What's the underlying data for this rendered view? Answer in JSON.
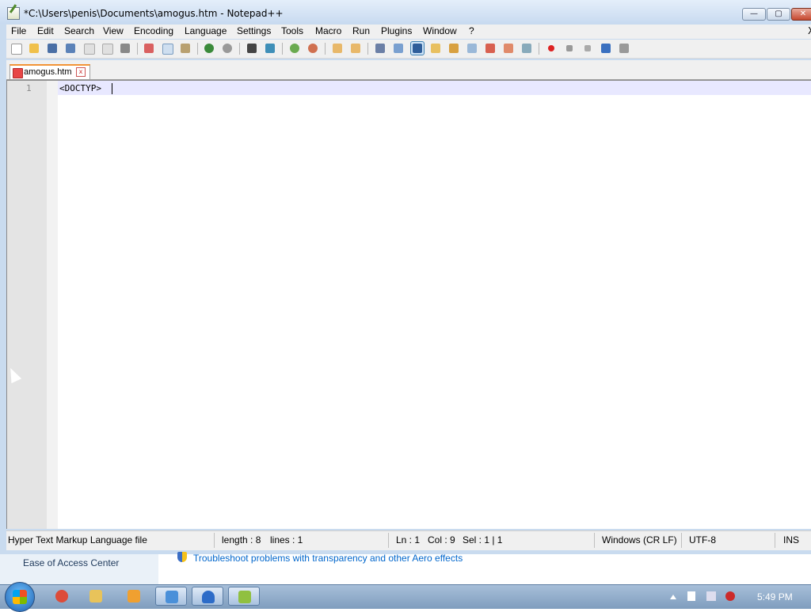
{
  "window": {
    "title": "*C:\\Users\\penis\\Documents\\amogus.htm - Notepad++",
    "minimize_glyph": "—",
    "maximize_glyph": "▢",
    "close_glyph": "✕"
  },
  "menu": {
    "items": [
      "File",
      "Edit",
      "Search",
      "View",
      "Encoding",
      "Language",
      "Settings",
      "Tools",
      "Macro",
      "Run",
      "Plugins",
      "Window",
      "?"
    ],
    "overflow_glyph": "X"
  },
  "toolbar": {
    "icons": [
      "new-file-icon",
      "open-file-icon",
      "save-icon",
      "save-all-icon",
      "close-icon",
      "close-all-icon",
      "print-icon",
      "cut-icon",
      "copy-icon",
      "paste-icon",
      "undo-icon",
      "redo-icon",
      "find-icon",
      "replace-icon",
      "zoom-in-icon",
      "zoom-out-icon",
      "sync-vertical-icon",
      "sync-horizontal-icon",
      "word-wrap-icon",
      "show-all-chars-icon",
      "indent-guide-icon",
      "user-language-icon",
      "doc-map-icon",
      "function-list-icon",
      "folder-workspace-icon",
      "monitoring-icon",
      "record-macro-icon",
      "stop-macro-icon",
      "play-macro-icon",
      "run-macro-multiple-icon",
      "save-macro-icon"
    ],
    "active_icon": "indent-guide-icon"
  },
  "tab": {
    "label": "amogus.htm",
    "close_glyph": "x"
  },
  "editor": {
    "line_number": "1",
    "code": "<DOCTYP>"
  },
  "status": {
    "file_type": "Hyper Text Markup Language file",
    "length": "length : 8",
    "lines": "lines : 1",
    "ln": "Ln : 1",
    "col": "Col : 9",
    "sel": "Sel : 1 | 1",
    "eol": "Windows (CR LF)",
    "encoding": "UTF-8",
    "mode": "INS"
  },
  "background": {
    "left_panel": "Ease of Access Center",
    "link": "Troubleshoot problems with transparency and other Aero effects"
  },
  "taskbar": {
    "clock": "5:49 PM",
    "buttons": [
      "chrome-icon",
      "file-explorer-icon",
      "media-player-icon",
      "control-panel-icon",
      "app-icon",
      "notepadpp-icon"
    ],
    "colors": {
      "chrome": "#dd4b39",
      "explorer": "#e8c35a",
      "media": "#f0a030",
      "control": "#4a90d9",
      "app": "#2d6cc8",
      "notepadpp": "#90c040"
    }
  }
}
